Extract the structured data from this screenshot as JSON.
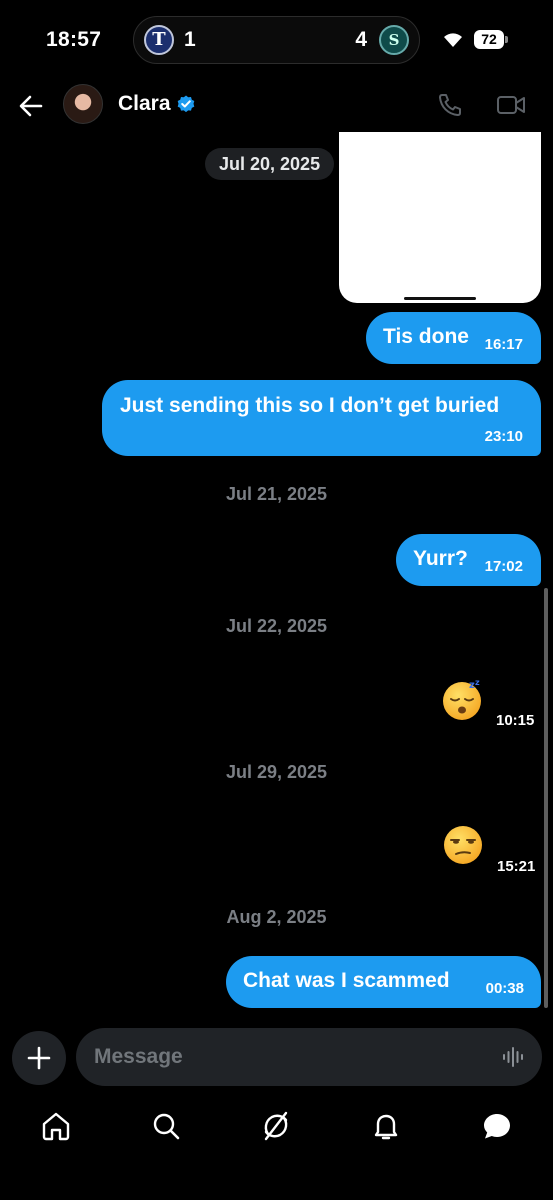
{
  "status_bar": {
    "time": "18:57",
    "live_score": {
      "home_team_letter": "T",
      "home_score": "1",
      "away_score": "4",
      "away_team_letter": "S"
    },
    "battery": "72"
  },
  "header": {
    "contact_name": "Clara",
    "verified": true,
    "icons": [
      "back-arrow-icon",
      "phone-icon",
      "video-camera-icon"
    ]
  },
  "conversation": {
    "floating_date": "Jul 20, 2025",
    "messages": [
      {
        "text": "Tis done",
        "time": "16:17"
      },
      {
        "text": "Just sending this so I don’t get buried",
        "time": "23:10"
      },
      {
        "date": "Jul 21, 2025"
      },
      {
        "text": "Yurr?",
        "time": "17:02"
      },
      {
        "date": "Jul 22, 2025"
      },
      {
        "emoji": "sleeping-face",
        "time": "10:15"
      },
      {
        "date": "Jul 29, 2025"
      },
      {
        "emoji": "unamused-face",
        "time": "15:21"
      },
      {
        "date": "Aug 2, 2025"
      },
      {
        "text": "Chat was I scammed",
        "time": "00:38"
      }
    ]
  },
  "composer": {
    "placeholder": "Message",
    "icons": [
      "plus-icon",
      "voice-wave-icon"
    ]
  },
  "bottom_nav": {
    "items": [
      "home",
      "search",
      "grok",
      "notifications",
      "messages"
    ],
    "active": "messages"
  },
  "colors": {
    "accent": "#1d9bf0",
    "background": "#000000",
    "muted_text": "#7b7f85",
    "input_bg": "#202327"
  }
}
